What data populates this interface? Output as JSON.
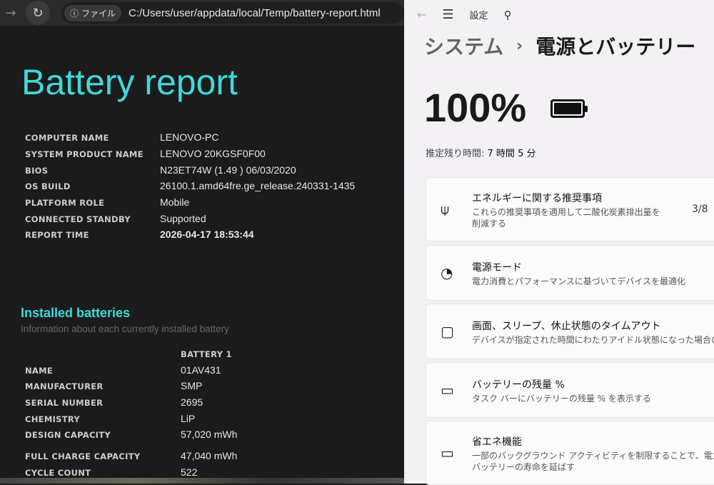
{
  "browser": {
    "forward_icon": "arrow-right-icon",
    "reload_icon": "reload-icon",
    "chip_label": "ファイル",
    "url": "C:/Users/user/appdata/local/Temp/battery-report.html"
  },
  "report": {
    "title": "Battery report",
    "info": [
      {
        "key": "COMPUTER NAME",
        "value": "LENOVO-PC"
      },
      {
        "key": "SYSTEM PRODUCT NAME",
        "value": "LENOVO 20KGSF0F00"
      },
      {
        "key": "BIOS",
        "value": "N23ET74W (1.49 ) 06/03/2020"
      },
      {
        "key": "OS BUILD",
        "value": "26100.1.amd64fre.ge_release.240331-1435"
      },
      {
        "key": "PLATFORM ROLE",
        "value": "Mobile"
      },
      {
        "key": "CONNECTED STANDBY",
        "value": "Supported"
      },
      {
        "key": "REPORT TIME",
        "value": "2026-04-17  18:53:44"
      }
    ],
    "installed_heading": "Installed batteries",
    "installed_sub": "Information about each currently installed battery",
    "battery_col": "BATTERY 1",
    "battery": [
      {
        "key": "NAME",
        "value": "01AV431"
      },
      {
        "key": "MANUFACTURER",
        "value": "SMP"
      },
      {
        "key": "SERIAL NUMBER",
        "value": "2695"
      },
      {
        "key": "CHEMISTRY",
        "value": "LiP"
      },
      {
        "key": "DESIGN CAPACITY",
        "value": "57,020 mWh"
      },
      {
        "key": "FULL CHARGE CAPACITY",
        "value": "47,040 mWh"
      },
      {
        "key": "CYCLE COUNT",
        "value": "522"
      }
    ]
  },
  "settings": {
    "app_title": "設定",
    "breadcrumb_parent": "システム",
    "breadcrumb_sep": "›",
    "breadcrumb_current": "電源とバッテリー",
    "percent": "100%",
    "estimate_label": "推定残り時間:",
    "estimate_value": "7 時間 5 分",
    "cards": [
      {
        "icon": "leaf-icon",
        "glyph": "⍦",
        "title": "エネルギーに関する推奨事項",
        "sub": "これらの推奨事項を適用して二酸化炭素排出量を",
        "sub2": "削減する",
        "value": "3/8"
      },
      {
        "icon": "gauge-icon",
        "glyph": "◔",
        "title": "電源モード",
        "sub": "電力消費とパフォーマンスに基づいてデバイスを最適化"
      },
      {
        "icon": "screen-sleep-icon",
        "glyph": "▢",
        "title": "画面、スリープ、休止状態のタイムアウト",
        "sub": "デバイスが指定された時間にわたりアイドル状態になった場合の動"
      },
      {
        "icon": "battery-percent-icon",
        "glyph": "▭",
        "title": "バッテリーの残量 %",
        "sub": "タスク バーにバッテリーの残量 % を表示する"
      },
      {
        "icon": "energy-saver-icon",
        "glyph": "▭",
        "title": "省エネ機能",
        "sub": "一部のバックグラウンド アクティビティを制限することで、電力消費",
        "sub2": "バッテリーの寿命を延ばす"
      }
    ]
  }
}
